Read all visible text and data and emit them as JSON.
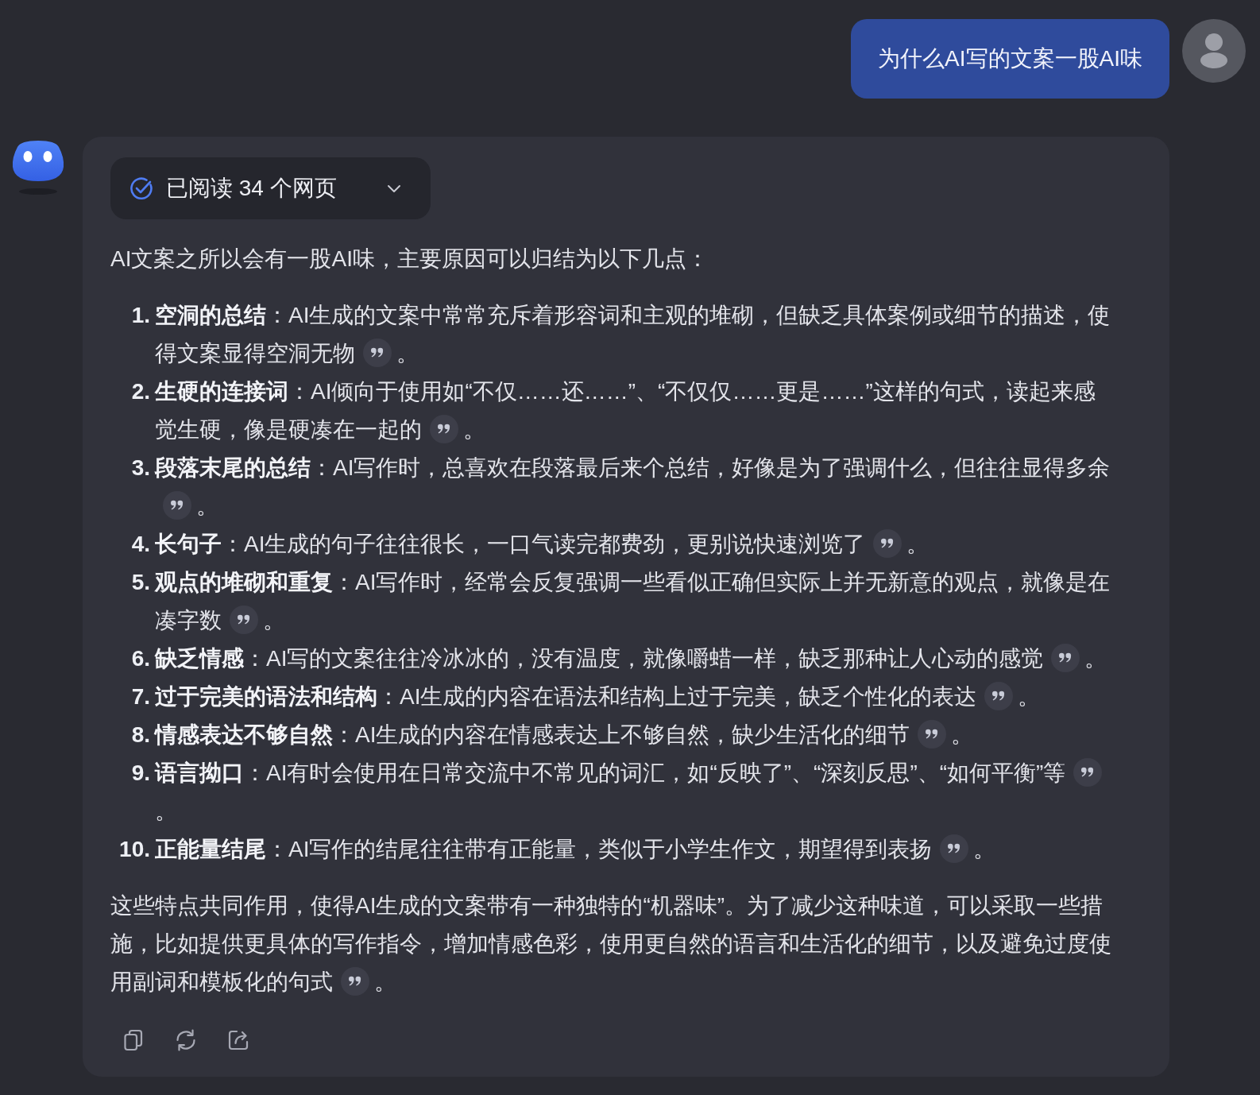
{
  "user_message": {
    "text": "为什么AI写的文案一股AI味"
  },
  "answer": {
    "sources": {
      "label": "已阅读 34 个网页",
      "expanded": false
    },
    "intro": "AI文案之所以会有一股AI味，主要原因可以归结为以下几点：",
    "points": [
      {
        "number": "1.",
        "text": "**空洞的总结**：AI生成的文案中常常充斥着形容词和主观的堆砌，但缺乏具体案例或细节的描述，使得文案显得空洞无物",
        "tail": "。"
      },
      {
        "number": "2.",
        "text": "**生硬的连接词**：AI倾向于使用如“不仅……还……”、“不仅仅……更是……”这样的句式，读起来感觉生硬，像是硬凑在一起的",
        "tail": "。"
      },
      {
        "number": "3.",
        "text": "**段落末尾的总结**：AI写作时，总喜欢在段落最后来个总结，好像是为了强调什么，但往往显得多余",
        "tail": "。"
      },
      {
        "number": "4.",
        "text": "**长句子**：AI生成的句子往往很长，一口气读完都费劲，更别说快速浏览了",
        "tail": "。"
      },
      {
        "number": "5.",
        "text": "**观点的堆砌和重复**：AI写作时，经常会反复强调一些看似正确但实际上并无新意的观点，就像是在凑字数",
        "tail": "。"
      },
      {
        "number": "6.",
        "text": "**缺乏情感**：AI写的文案往往冷冰冰的，没有温度，就像嚼蜡一样，缺乏那种让人心动的感觉",
        "tail": "。"
      },
      {
        "number": "7.",
        "text": "**过于完美的语法和结构**：AI生成的内容在语法和结构上过于完美，缺乏个性化的表达",
        "tail": "。"
      },
      {
        "number": "8.",
        "text": "**情感表达不够自然**：AI生成的内容在情感表达上不够自然，缺少生活化的细节",
        "tail": "。"
      },
      {
        "number": "9.",
        "text": "**语言拗口**：AI有时会使用在日常交流中不常见的词汇，如“反映了”、“深刻反思”、“如何平衡”等",
        "tail": "。"
      },
      {
        "number": "10.",
        "text": "**正能量结尾**：AI写作的结尾往往带有正能量，类似于小学生作文，期望得到表扬",
        "tail": "。"
      }
    ],
    "conclusion": {
      "text": "这些特点共同作用，使得AI生成的文案带有一种独特的“机器味”。为了减少这种味道，可以采取一些措施，比如提供更具体的写作指令，增加情感色彩，使用更自然的语言和生活化的细节，以及避免过度使用副词和模板化的句式",
      "tail": "。"
    },
    "actions": [
      {
        "kind": "copy"
      },
      {
        "kind": "regenerate"
      },
      {
        "kind": "share"
      }
    ]
  }
}
